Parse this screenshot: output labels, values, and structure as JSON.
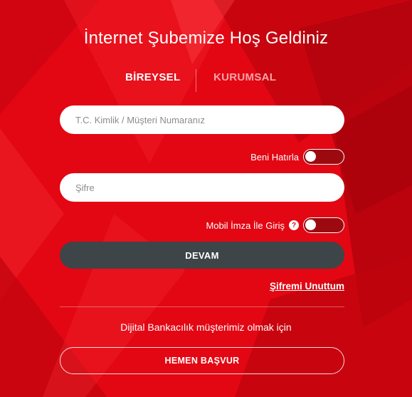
{
  "page": {
    "title": "İnternet Şubemize Hoş Geldiniz",
    "accent_color": "#e30613",
    "dark_button_color": "#3d4549"
  },
  "tabs": [
    {
      "label": "BİREYSEL",
      "active": true
    },
    {
      "label": "KURUMSAL",
      "active": false
    }
  ],
  "login_form": {
    "id_field": {
      "placeholder": "T.C. Kimlik / Müşteri Numaranız",
      "value": ""
    },
    "remember_me": {
      "label": "Beni Hatırla",
      "checked": false
    },
    "password_field": {
      "placeholder": "Şifre",
      "value": ""
    },
    "mobile_signature": {
      "label": "Mobil İmza İle Giriş",
      "help_icon": "question-mark",
      "checked": false
    },
    "continue_label": "DEVAM",
    "forgot_password_label": "Şifremi Unuttum"
  },
  "signup": {
    "promo_text": "Dijital Bankacılık müşterimiz olmak için",
    "apply_label": "HEMEN BAŞVUR"
  }
}
